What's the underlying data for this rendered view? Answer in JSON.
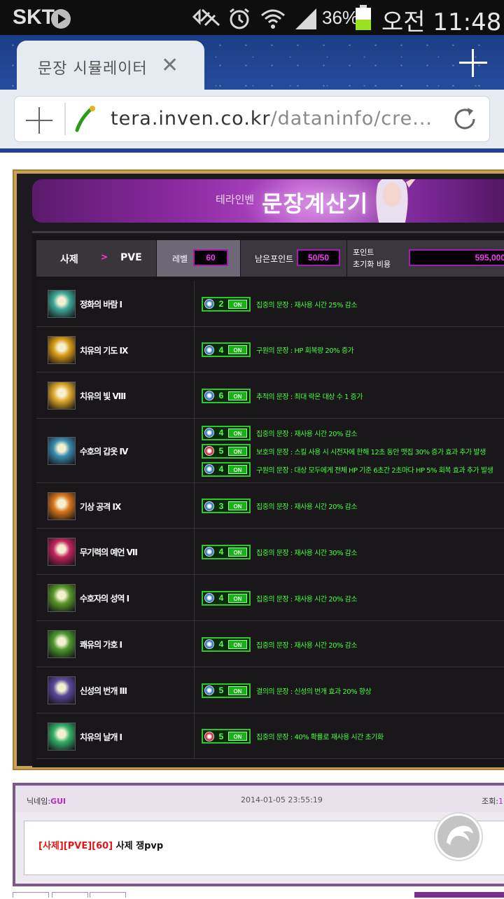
{
  "status_bar": {
    "carrier": "SKT",
    "battery_percent": "36%",
    "time": "오전 11:48"
  },
  "browser": {
    "tab_title": "문장 시뮬레이터",
    "url_host": "tera.inven.co.kr",
    "url_path": "/dataninfo/cre..."
  },
  "calculator": {
    "banner_small": "테라인벤",
    "banner_title": "문장계산기",
    "header": {
      "class_name": "사제",
      "arrow": ">",
      "mode": "PVE",
      "level_label": "레벨",
      "level_value": "60",
      "points_label": "남은포인트",
      "points_value": "50/50",
      "reset_label_1": "포인트",
      "reset_label_2": "초기화 비용",
      "reset_value": "595,000"
    },
    "skills": [
      {
        "name": "정화의 바람 I",
        "icon_color": "#3fa89a",
        "glyphs": [
          {
            "icon": "#2b6fb0",
            "num": "2",
            "on": "ON",
            "desc": "집중의 문장 : 재사용 시간 25% 감소"
          }
        ]
      },
      {
        "name": "치유의 기도 IX",
        "icon_color": "#d79a16",
        "glyphs": [
          {
            "icon": "#2b6fb0",
            "num": "4",
            "on": "ON",
            "desc": "구원의 문장 : HP 회복량 20% 증가"
          }
        ]
      },
      {
        "name": "치유의 빛 VIII",
        "icon_color": "#e0a82a",
        "glyphs": [
          {
            "icon": "#2b6fb0",
            "num": "6",
            "on": "ON",
            "desc": "추적의 문장 : 최대 락온 대상 수 1 증가"
          }
        ]
      },
      {
        "name": "수호의 갑옷 IV",
        "icon_color": "#3a8bb0",
        "glyphs": [
          {
            "icon": "#2b6fb0",
            "num": "4",
            "on": "ON",
            "desc": "집중의 문장 : 재사용 시간 20% 감소"
          },
          {
            "icon": "#c0282e",
            "num": "5",
            "on": "ON",
            "desc": "보호의 문장 : 스킬 사용 시 시전자에 한해 12초 동안 맷집 30% 증가 효과 추가 발생"
          },
          {
            "icon": "#2b6fb0",
            "num": "4",
            "on": "ON",
            "desc": "구원의 문장 : 대상 모두에게 전체 HP 기준 6초간 2초마다 HP 5% 회복 효과 추가 발생"
          }
        ]
      },
      {
        "name": "기상 공격 IX",
        "icon_color": "#d8761c",
        "glyphs": [
          {
            "icon": "#2b6fb0",
            "num": "3",
            "on": "ON",
            "desc": "집중의 문장 : 재사용 시간 20% 감소"
          }
        ]
      },
      {
        "name": "무기력의 예언 VII",
        "icon_color": "#c2245c",
        "glyphs": [
          {
            "icon": "#2b6fb0",
            "num": "4",
            "on": "ON",
            "desc": "집중의 문장 : 재사용 시간 30% 감소"
          }
        ]
      },
      {
        "name": "수호자의 성역 I",
        "icon_color": "#5a9a2a",
        "glyphs": [
          {
            "icon": "#2b6fb0",
            "num": "4",
            "on": "ON",
            "desc": "집중의 문장 : 재사용 시간 20% 감소"
          }
        ]
      },
      {
        "name": "쾌유의 가호 I",
        "icon_color": "#4e9a2e",
        "glyphs": [
          {
            "icon": "#2b6fb0",
            "num": "4",
            "on": "ON",
            "desc": "집중의 문장 : 재사용 시간 20% 감소"
          }
        ]
      },
      {
        "name": "신성의 번개 III",
        "icon_color": "#5a4a9c",
        "glyphs": [
          {
            "icon": "#2b6fb0",
            "num": "5",
            "on": "ON",
            "desc": "결의의 문장 : 신성의 번개 효과 20% 향상"
          }
        ]
      },
      {
        "name": "치유의 날개 I",
        "icon_color": "#34b06a",
        "glyphs": [
          {
            "icon": "#c0282e",
            "num": "5",
            "on": "ON",
            "desc": "집중의 문장 : 40% 확률로 재사용 시간 초기화"
          }
        ]
      }
    ]
  },
  "post": {
    "nick_label": "닉네임:",
    "nick_value": "GUI",
    "date": "2014-01-05 23:55:19",
    "views_label": "조회:",
    "views_value": "1",
    "tag": "[사제][PVE][60]",
    "text": " 사제 쟁pvp"
  }
}
